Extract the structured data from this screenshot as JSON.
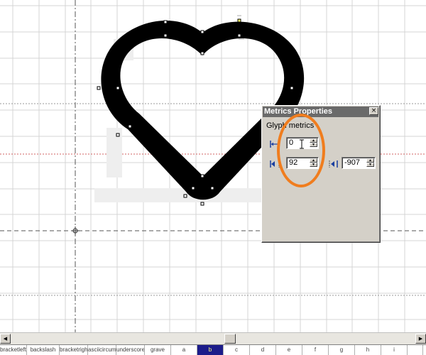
{
  "panel": {
    "title": "Metrics Properties",
    "close_glyph": "×",
    "section": "Glyph metrics",
    "lsb_value": "0",
    "rsb_value": "92",
    "width_value": "-907",
    "icons": [
      "left-side-bearing-icon",
      "right-side-bearing-icon",
      "advance-width-icon"
    ]
  },
  "scrollbar": {
    "left_arrow": "◀",
    "right_arrow": "▶"
  },
  "glyph_strip": {
    "selected": "b",
    "cells": [
      "bracketleft",
      "backslash",
      "bracketright",
      "asciicircum",
      "underscore",
      "grave",
      "a",
      "b",
      "c",
      "d",
      "e",
      "f",
      "g",
      "h",
      "i",
      ""
    ]
  },
  "colors": {
    "highlight": "#f07d1e",
    "glyph_fill": "#000000",
    "selected_cell_bg": "#1c1c8a",
    "selected_cell_text": "#ffff80"
  }
}
